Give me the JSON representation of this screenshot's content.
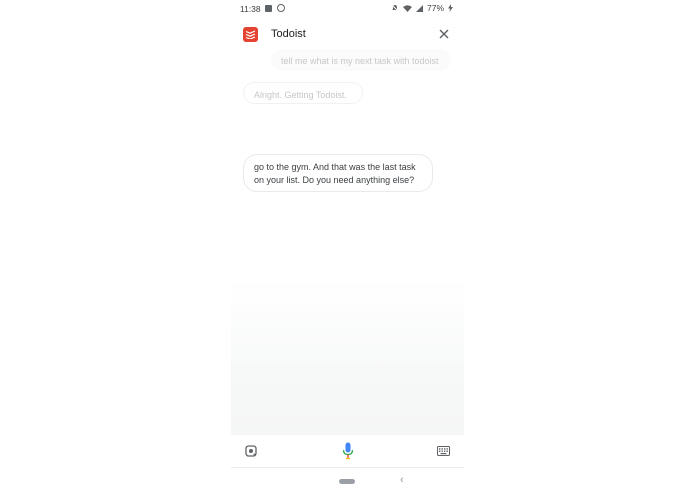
{
  "status_bar": {
    "time": "11:38",
    "left_icons": [
      "image-icon",
      "alarm-icon"
    ],
    "right_icons": [
      "notifications-off-icon",
      "wifi-icon",
      "signal-icon",
      "battery-charging-icon"
    ],
    "battery": "77%"
  },
  "header": {
    "app_name": "Todoist",
    "logo_icon": "todoist-logo",
    "close_icon": "close-icon",
    "brand_color": "#e44332"
  },
  "conversation": {
    "user_query": "tell me what is my next task with todoist",
    "assistant_ack": "Alright. Getting Todoist.",
    "assistant_response": "go to the gym. And that was the last task on your list. Do you need anything else?"
  },
  "bottom_bar": {
    "left_icon": "lens-icon",
    "center_icon": "mic-icon",
    "right_icon": "keyboard-icon"
  },
  "nav": {
    "back_glyph": "‹"
  }
}
